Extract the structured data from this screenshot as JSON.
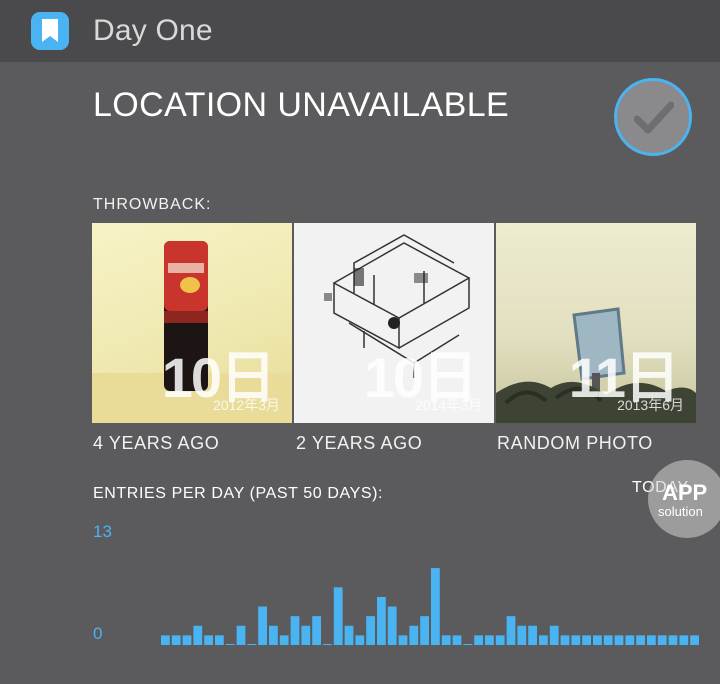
{
  "header": {
    "app_name": "Day One",
    "icon": "bookmark-icon"
  },
  "location": {
    "text": "LOCATION UNAVAILABLE",
    "check_icon": "checkmark-icon"
  },
  "throwback": {
    "label": "THROWBACK:",
    "items": [
      {
        "caption": "4 YEARS AGO",
        "big_date": "10日",
        "small_date": "2012年3月"
      },
      {
        "caption": "2 YEARS AGO",
        "big_date": "10日",
        "small_date": "2014年3月"
      },
      {
        "caption": "RANDOM PHOTO",
        "big_date": "11日",
        "small_date": "2013年6月"
      }
    ]
  },
  "entries": {
    "label": "ENTRIES PER DAY (PAST 50 DAYS):",
    "today_label": "TODAY",
    "y_max_label": "13",
    "y_min_label": "0"
  },
  "watermark": {
    "line1": "APP",
    "line2": "solution"
  },
  "colors": {
    "accent": "#4ab3f2",
    "background": "#5b5b5d",
    "header": "#4a4a4c"
  },
  "chart_data": {
    "type": "bar",
    "title": "ENTRIES PER DAY (PAST 50 DAYS):",
    "ylim": [
      0,
      13
    ],
    "x": [
      1,
      2,
      3,
      4,
      5,
      6,
      7,
      8,
      9,
      10,
      11,
      12,
      13,
      14,
      15,
      16,
      17,
      18,
      19,
      20,
      21,
      22,
      23,
      24,
      25,
      26,
      27,
      28,
      29,
      30,
      31,
      32,
      33,
      34,
      35,
      36,
      37,
      38,
      39,
      40,
      41,
      42,
      43,
      44,
      45,
      46,
      47,
      48,
      49,
      50
    ],
    "values": [
      1,
      1,
      1,
      2,
      1,
      1,
      0,
      2,
      0,
      4,
      2,
      1,
      3,
      2,
      3,
      0,
      6,
      2,
      1,
      3,
      5,
      4,
      1,
      2,
      3,
      8,
      1,
      1,
      0,
      1,
      1,
      1,
      3,
      2,
      2,
      1,
      2,
      1,
      1,
      1,
      1,
      1,
      1,
      1,
      1,
      1,
      1,
      1,
      1,
      1
    ]
  }
}
